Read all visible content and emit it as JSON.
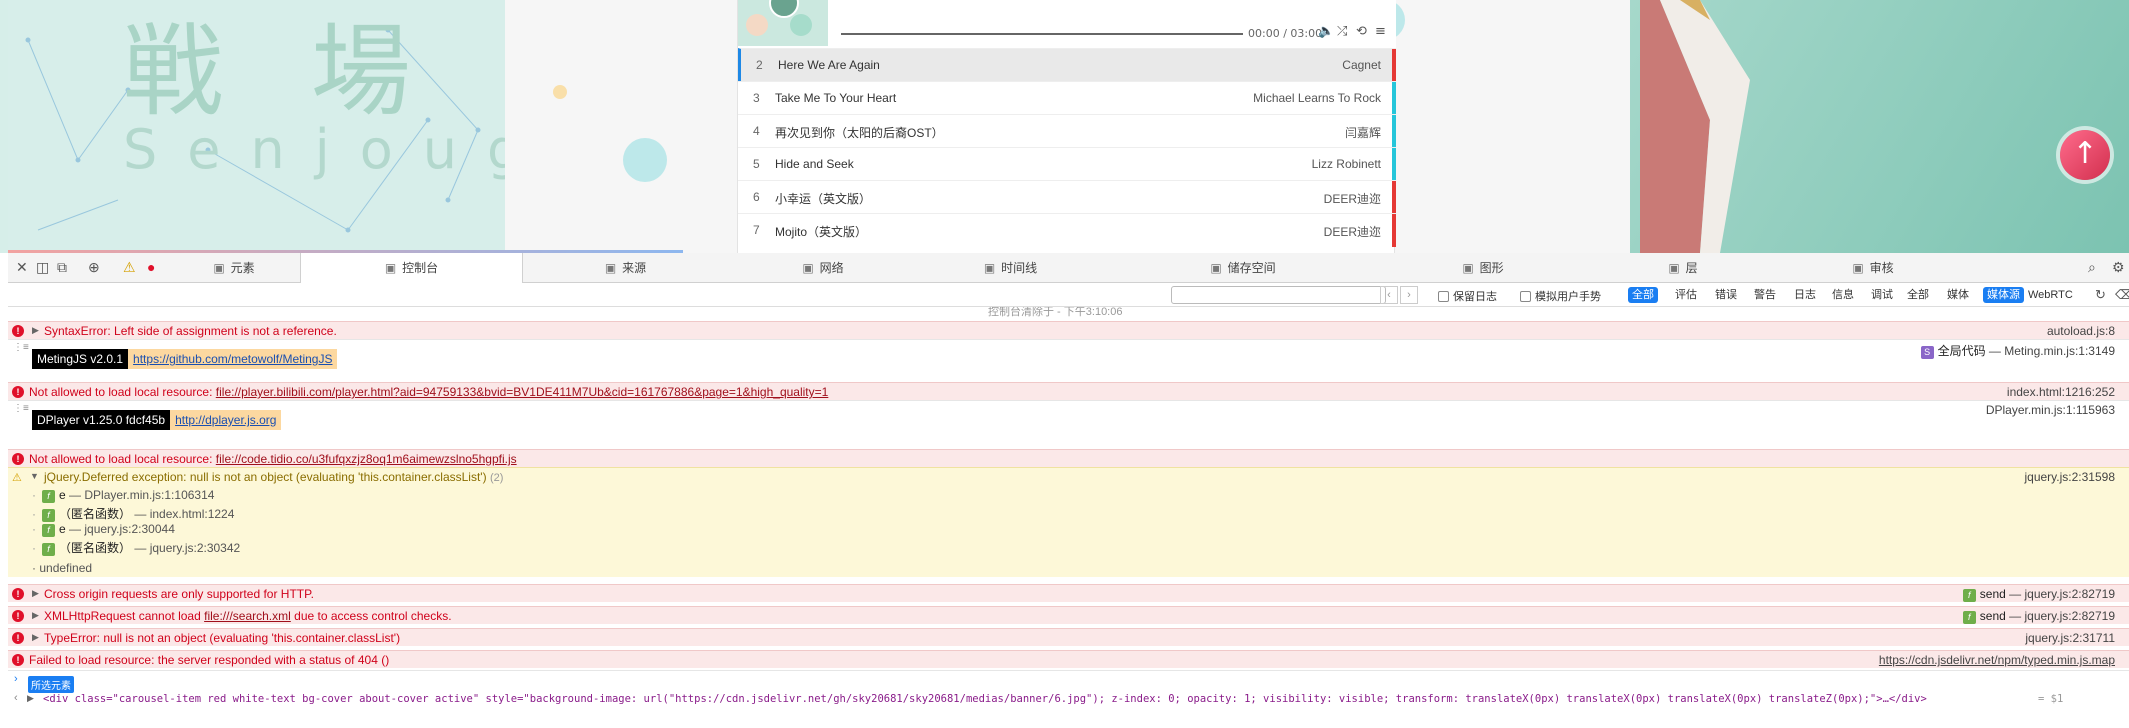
{
  "webpage": {
    "hero_kanji": "戦 場 ケ",
    "hero_romaji": "Senjouga",
    "player": {
      "time": "00:00 / 03:00",
      "tracks": [
        {
          "index": "2",
          "title": "Here We Are Again",
          "artist": "Cagnet",
          "active": true,
          "bar_color": "#e53935"
        },
        {
          "index": "3",
          "title": "Take Me To Your Heart",
          "artist": "Michael Learns To Rock",
          "active": false,
          "bar_color": "#26c6da"
        },
        {
          "index": "4",
          "title": "再次见到你（太阳的后裔OST）",
          "artist": "闫嘉辉",
          "active": false,
          "bar_color": "#26c6da"
        },
        {
          "index": "5",
          "title": "Hide and Seek",
          "artist": "Lizz Robinett",
          "active": false,
          "bar_color": "#26c6da"
        },
        {
          "index": "6",
          "title": "小幸运（英文版）",
          "artist": "DEER迪迩",
          "active": false,
          "bar_color": "#e53935"
        },
        {
          "index": "7",
          "title": "Mojito（英文版）",
          "artist": "DEER迪迩",
          "active": false,
          "bar_color": "#e53935"
        }
      ]
    }
  },
  "devtools": {
    "tabs": [
      {
        "label": "元素",
        "icon": "elements-icon"
      },
      {
        "label": "控制台",
        "icon": "console-icon"
      },
      {
        "label": "来源",
        "icon": "sources-icon"
      },
      {
        "label": "网络",
        "icon": "network-icon"
      },
      {
        "label": "时间线",
        "icon": "timeline-icon"
      },
      {
        "label": "储存空间",
        "icon": "storage-icon"
      },
      {
        "label": "图形",
        "icon": "graphics-icon"
      },
      {
        "label": "层",
        "icon": "layers-icon"
      },
      {
        "label": "审核",
        "icon": "audit-icon"
      }
    ],
    "active_tab": "控制台",
    "filter": {
      "placeholder": "",
      "preserve_log": "保留日志",
      "emulate_gesture": "模拟用户手势",
      "levels": [
        "全部",
        "评估",
        "错误",
        "警告",
        "日志",
        "信息",
        "调试"
      ],
      "sources": [
        "全部",
        "媒体",
        "媒体源",
        "WebRTC"
      ],
      "active_level": "全部",
      "active_source": "媒体源"
    },
    "console": {
      "scrolled_hint": "控制台清除于 - 下午3:10:06",
      "m1": {
        "text": "SyntaxError: Left side of assignment is not a reference.",
        "source": "autoload.js:8"
      },
      "m2": {
        "badge": "MetingJS v2.0.1",
        "link": "https://github.com/metowolf/MetingJS",
        "scope": "全局代码",
        "source": "Meting.min.js:1:3149"
      },
      "m3": {
        "prefix": "Not allowed to load local resource: ",
        "link": "file://player.bilibili.com/player.html?aid=94759133&bvid=BV1DE411M7Ub&cid=161767886&page=1&high_quality=1",
        "source": "index.html:1216:252"
      },
      "m4": {
        "badge": "DPlayer v1.25.0 fdcf45b",
        "link": "http://dplayer.js.org",
        "source": "DPlayer.min.js:1:115963"
      },
      "m5": {
        "prefix": "Not allowed to load local resource: ",
        "link": "file://code.tidio.co/u3fufqxzjz8oq1m6aimewzslno5hgpfi.js"
      },
      "m6": {
        "text": "jQuery.Deferred exception: null is not an object (evaluating 'this.container.classList')",
        "count": "(2)",
        "source": "jquery.js:2:31598",
        "stack": [
          {
            "fn": "e",
            "loc": "DPlayer.min.js:1:106314"
          },
          {
            "fn": "（匿名函数）",
            "loc": "index.html:1224"
          },
          {
            "fn": "e",
            "loc": "jquery.js:2:30044"
          },
          {
            "fn": "（匿名函数）",
            "loc": "jquery.js:2:30342"
          }
        ],
        "undefined": "undefined"
      },
      "m7": {
        "text": "Cross origin requests are only supported for HTTP.",
        "fn": "send",
        "source": "jquery.js:2:82719"
      },
      "m8": {
        "prefix": "XMLHttpRequest cannot load ",
        "link": "file:///search.xml",
        "suffix": " due to access control checks.",
        "fn": "send",
        "source": "jquery.js:2:82719"
      },
      "m9": {
        "text": "TypeError: null is not an object (evaluating 'this.container.classList')",
        "source": "jquery.js:2:31711"
      },
      "m10": {
        "text": "Failed to load resource: the server responded with a status of 404 ()",
        "source": "https://cdn.jsdelivr.net/npm/typed.min.js.map"
      },
      "selected_badge": "所选元素",
      "command_line": "<div class=\"carousel-item red white-text bg-cover about-cover active\" style=\"background-image: url(\"https://cdn.jsdelivr.net/gh/sky20681/sky20681/medias/banner/6.jpg\"); z-index: 0; opacity: 1; visibility: visible; transform: translateX(0px) translateX(0px) translateX(0px) translateZ(0px);\">…</div>",
      "command_result": "= $1"
    }
  },
  "colors": {
    "error": "#d0021b",
    "accent": "#1a7ef2",
    "warning_bg": "#fdf8d8",
    "error_bg": "#fbe8e8"
  }
}
